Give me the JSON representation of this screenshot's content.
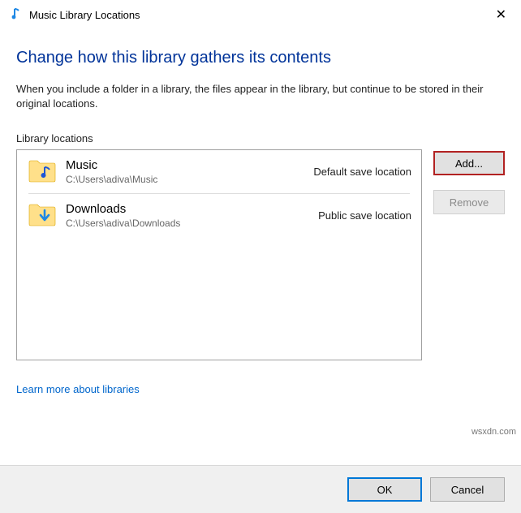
{
  "titlebar": {
    "title": "Music Library Locations",
    "close_symbol": "✕"
  },
  "heading": "Change how this library gathers its contents",
  "description": "When you include a folder in a library, the files appear in the library, but continue to be stored in their original locations.",
  "section_label": "Library locations",
  "locations": [
    {
      "name": "Music",
      "path": "C:\\Users\\adiva\\Music",
      "status": "Default save location",
      "icon": "music"
    },
    {
      "name": "Downloads",
      "path": "C:\\Users\\adiva\\Downloads",
      "status": "Public save location",
      "icon": "download"
    }
  ],
  "buttons": {
    "add": "Add...",
    "remove": "Remove"
  },
  "link_text": "Learn more about libraries",
  "footer": {
    "ok": "OK",
    "cancel": "Cancel"
  },
  "watermark": "wsxdn.com"
}
